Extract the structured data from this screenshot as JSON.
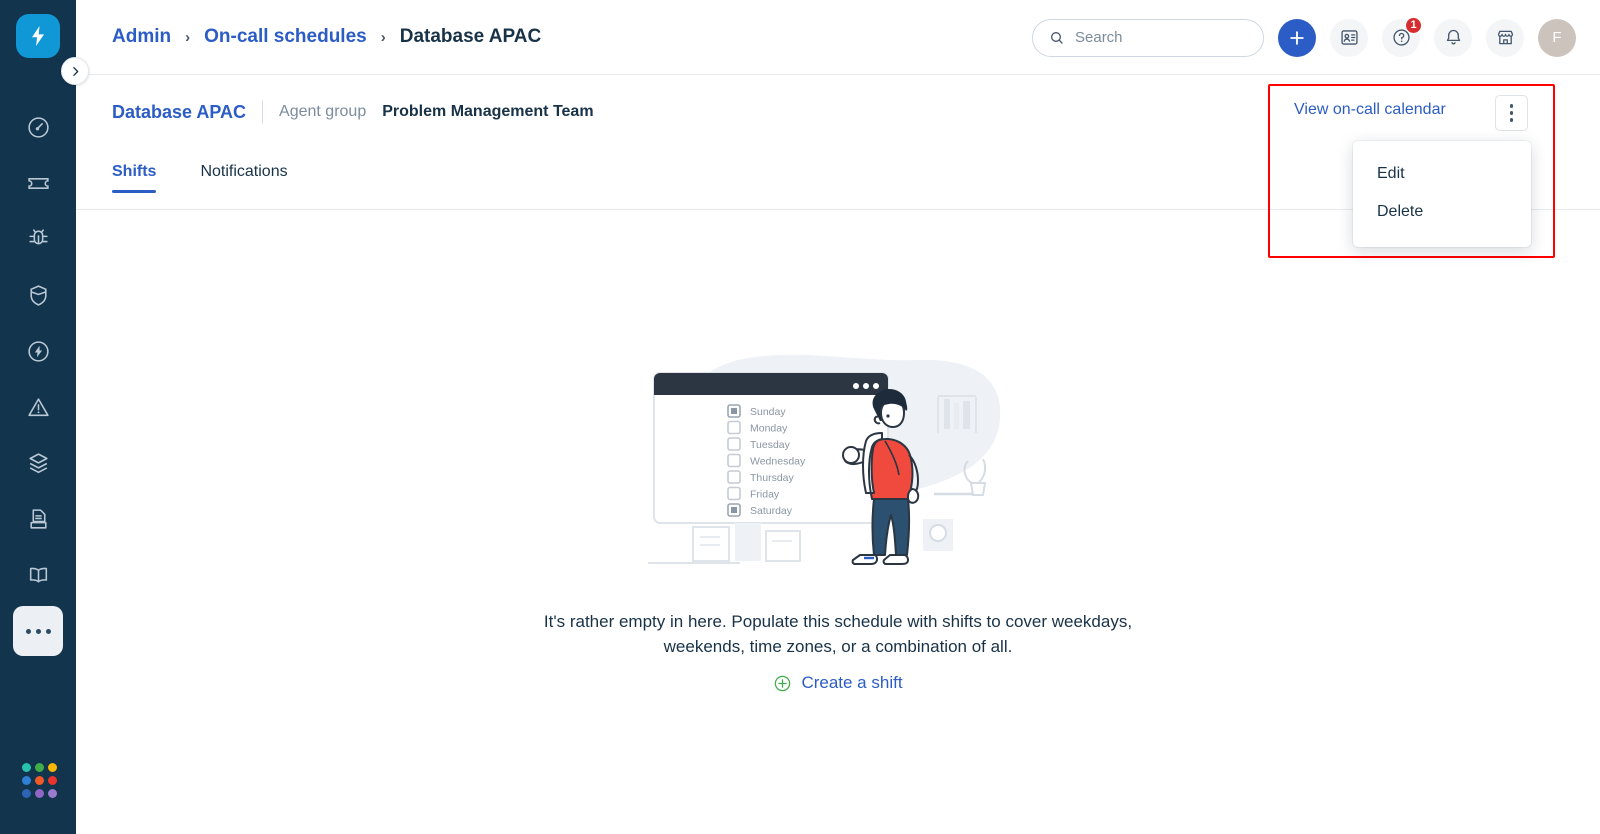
{
  "sidebar": {
    "brand_icon": "lightning-bolt-logo",
    "collapse_icon": "chevron-right-icon",
    "items": [
      {
        "icon": "dashboard-gauge-icon",
        "name": "dashboard",
        "has_kebab": false
      },
      {
        "icon": "ticket-icon",
        "name": "tickets",
        "has_kebab": true
      },
      {
        "icon": "bug-icon",
        "name": "changes",
        "has_kebab": false
      },
      {
        "icon": "shield-icon",
        "name": "problems",
        "has_kebab": false
      },
      {
        "icon": "lightning-circle-icon",
        "name": "releases",
        "has_kebab": false
      },
      {
        "icon": "alert-triangle-icon",
        "name": "alerts",
        "has_kebab": true
      },
      {
        "icon": "layers-icon",
        "name": "assets",
        "has_kebab": true
      },
      {
        "icon": "archive-document-icon",
        "name": "contracts",
        "has_kebab": true
      },
      {
        "icon": "book-icon",
        "name": "solutions",
        "has_kebab": false
      },
      {
        "icon": "more-dots-icon",
        "name": "more",
        "has_kebab": false,
        "active": true
      }
    ],
    "logo_colors": [
      "#28c3ab",
      "#3fae49",
      "#f8b700",
      "#2f7fd4",
      "#f05a28",
      "#e8342b",
      "#2d64b3",
      "#8e66c4",
      "#9a7bd0"
    ]
  },
  "header": {
    "breadcrumb": [
      {
        "label": "Admin",
        "type": "link"
      },
      {
        "label": "On-call schedules",
        "type": "link"
      },
      {
        "label": "Database APAC",
        "type": "current"
      }
    ],
    "separator": "›",
    "search": {
      "placeholder": "Search",
      "value": "",
      "icon": "search-icon"
    },
    "actions": [
      {
        "name": "add-button",
        "icon": "plus-icon",
        "badge": ""
      },
      {
        "name": "contact-card-button",
        "icon": "contact-card-icon",
        "badge": ""
      },
      {
        "name": "help-button",
        "icon": "question-circle-icon",
        "badge": "1"
      },
      {
        "name": "notifications-button",
        "icon": "bell-icon",
        "badge": ""
      },
      {
        "name": "marketplace-button",
        "icon": "marketplace-store-icon",
        "badge": ""
      }
    ],
    "avatar_initial": "F"
  },
  "subheader": {
    "schedule_name": "Database APAC",
    "meta_label": "Agent group",
    "meta_value": "Problem Management Team",
    "tabs": [
      {
        "label": "Shifts",
        "active": true
      },
      {
        "label": "Notifications",
        "active": false
      }
    ]
  },
  "actions": {
    "calendar_link": "View on-call calendar",
    "kebab_icon": "kebab-menu-icon",
    "menu": [
      {
        "label": "Edit"
      },
      {
        "label": "Delete"
      }
    ],
    "highlight_color": "#ff0000"
  },
  "empty_state": {
    "message": "It's rather empty in here. Populate this schedule with shifts to cover weekdays, weekends, time zones, or a combination of all.",
    "cta_label": "Create a shift",
    "cta_icon": "plus-circle-icon",
    "illustration": {
      "name": "empty-schedule-illustration",
      "days": [
        {
          "label": "Sunday",
          "checked": true
        },
        {
          "label": "Monday",
          "checked": false
        },
        {
          "label": "Tuesday",
          "checked": false
        },
        {
          "label": "Wednesday",
          "checked": false
        },
        {
          "label": "Thursday",
          "checked": false
        },
        {
          "label": "Friday",
          "checked": false
        },
        {
          "label": "Saturday",
          "checked": true
        }
      ]
    }
  },
  "colors": {
    "sidebar_bg": "#12344d",
    "accent_blue": "#2c5cc5",
    "brand_blue": "#1097d6",
    "text_dark": "#183247",
    "green": "#3fae49",
    "red": "#d72d30"
  }
}
